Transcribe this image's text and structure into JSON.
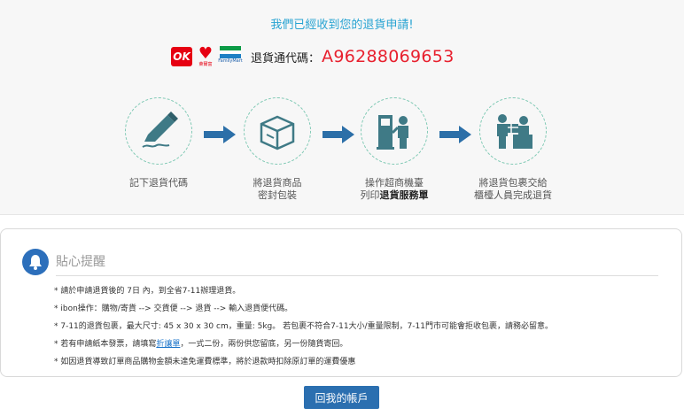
{
  "header": {
    "title": "我們已經收到您的退貨申請!",
    "code_label": "退貨通代碼：",
    "code_value": "A96288069653",
    "logos": [
      {
        "name": "ok-mart-logo",
        "text": "OK",
        "color": "#e60012"
      },
      {
        "name": "hilife-logo",
        "text": "Hi-Life",
        "sub": "萊爾富",
        "color": "#e60012"
      },
      {
        "name": "familymart-logo",
        "sub": "FamilyMart",
        "colors": [
          "#0c9b46",
          "#1d7fc4"
        ]
      }
    ]
  },
  "steps": [
    {
      "icon": "pen-writing-icon",
      "line1": "記下退貨代碼",
      "line2": ""
    },
    {
      "icon": "package-box-icon",
      "line1": "將退貨商品",
      "line2": "密封包裝"
    },
    {
      "icon": "kiosk-machine-icon",
      "line1": "操作超商機臺",
      "line2_prefix": "列印",
      "line2_bold": "退貨服務單"
    },
    {
      "icon": "counter-clerk-icon",
      "line1": "將退貨包裹交給",
      "line2": "櫃檯人員完成退貨"
    }
  ],
  "notice": {
    "title": "貼心提醒",
    "items": [
      {
        "text": "* 請於申請退貨後的 7日 內，到全省7-11辦理退貨。"
      },
      {
        "text": "* ibon操作：購物/寄貨 --> 交貨便 --> 退貨 --> 輸入退貨便代碼。"
      },
      {
        "text": "* 7-11的退貨包裹，最大尺寸: 45 x 30 x 30 cm，重量: 5kg。 若包裹不符合7-11大小/重量限制，7-11門市可能會拒收包裹，請務必留意。"
      },
      {
        "prefix": "* 若有申請紙本發票，請填寫",
        "link": "折讓單",
        "suffix": "，一式二份，兩份供您留底，另一份隨貨寄回。"
      },
      {
        "text": "* 如因退貨導致訂單商品購物金額未達免運費標準，將於退款時扣除原訂單的運費優惠"
      }
    ]
  },
  "footer": {
    "back_button": "回我的帳戶"
  },
  "colors": {
    "accent_blue": "#27a3d2",
    "code_red": "#e8202e",
    "icon_green": "#7fc9b4",
    "arrow_blue": "#2c6fa8",
    "button_blue": "#2b6fb0"
  }
}
